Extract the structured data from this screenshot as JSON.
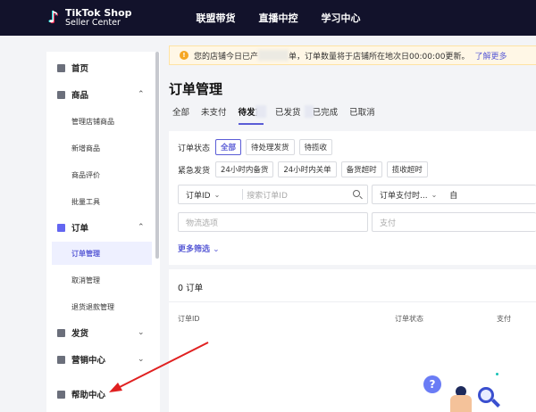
{
  "brand": {
    "line1": "TikTok Shop",
    "line2": "Seller Center"
  },
  "topnav": [
    "联盟带货",
    "直播中控",
    "学习中心"
  ],
  "sidebar": {
    "items": [
      {
        "label": "首页",
        "type": "top",
        "icon": "home-icon"
      },
      {
        "label": "商品",
        "type": "top",
        "icon": "product-icon",
        "chevron": "up"
      },
      {
        "label": "管理店铺商品",
        "type": "sub"
      },
      {
        "label": "新增商品",
        "type": "sub"
      },
      {
        "label": "商品评价",
        "type": "sub"
      },
      {
        "label": "批量工具",
        "type": "sub"
      },
      {
        "label": "订单",
        "type": "top",
        "icon": "order-icon",
        "chevron": "up"
      },
      {
        "label": "订单管理",
        "type": "sub",
        "active": true
      },
      {
        "label": "取消管理",
        "type": "sub"
      },
      {
        "label": "退货退款管理",
        "type": "sub"
      },
      {
        "label": "发货",
        "type": "top",
        "icon": "shipping-icon",
        "chevron": "down"
      },
      {
        "label": "营销中心",
        "type": "top",
        "icon": "marketing-icon",
        "chevron": "down"
      },
      {
        "label": "帮助中心",
        "type": "top",
        "icon": "help-icon"
      }
    ]
  },
  "notice": {
    "text_before": "您的店铺今日已产",
    "text_after": "单，订单数量将于店铺所在地次日00:00:00更新。",
    "link": "了解更多"
  },
  "page_title": "订单管理",
  "tabs": [
    "全部",
    "未支付",
    "待发货",
    "已发货",
    "已完成",
    "已取消"
  ],
  "active_tab": "待发货",
  "filters": {
    "order_status_label": "订单状态",
    "order_status_chips": [
      "全部",
      "待处理发货",
      "待揽收"
    ],
    "urgent_label": "紧急发货",
    "urgent_chips": [
      "24小时内备货",
      "24小时内关单",
      "备货超时",
      "揽收超时"
    ],
    "order_id_select": "订单ID",
    "search_placeholder": "搜索订单ID",
    "pay_time_select": "订单支付时...",
    "pay_time_from": "自",
    "logistics_placeholder": "物流选项",
    "payment_placeholder": "支付",
    "more_filters": "更多筛选"
  },
  "orders": {
    "count_label": "0 订单",
    "columns": [
      "订单ID",
      "订单状态",
      "支付"
    ]
  },
  "help_glyph": "?",
  "colors": {
    "accent": "#5a5cd6",
    "topbar": "#12122b",
    "warning": "#f5a623",
    "arrow": "#e02020"
  }
}
